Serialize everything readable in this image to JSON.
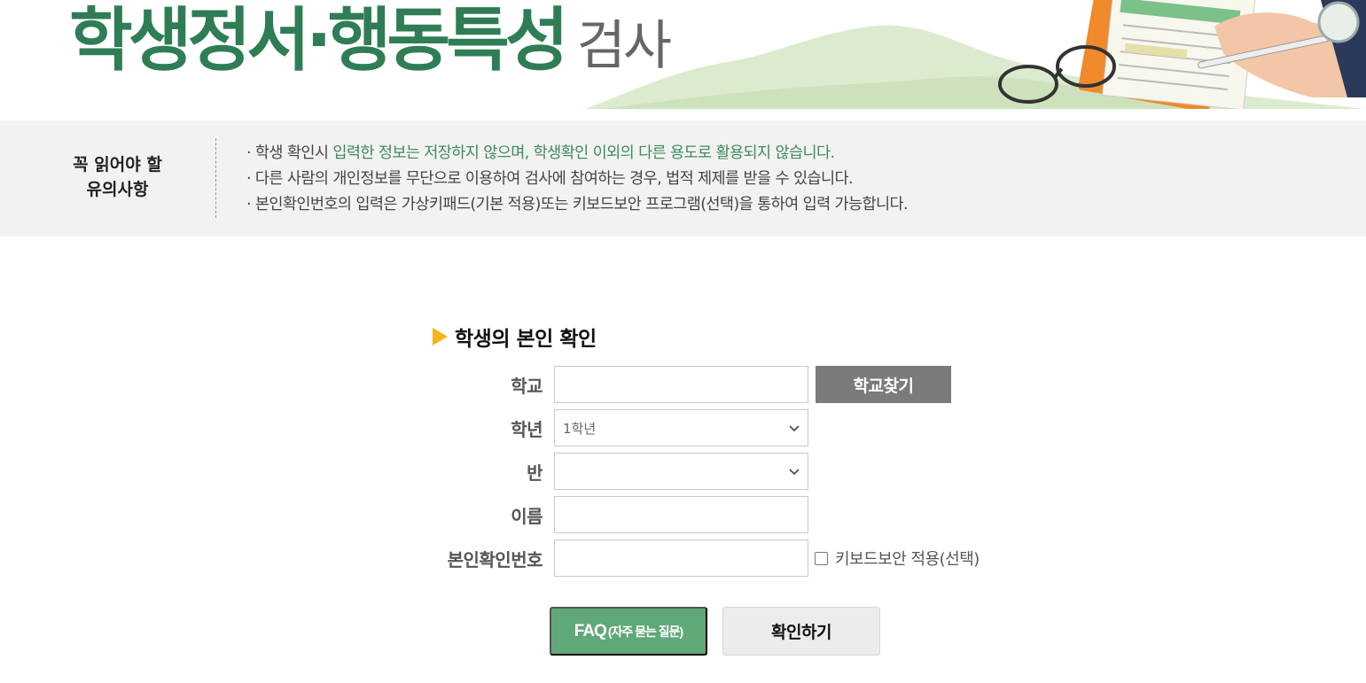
{
  "header": {
    "title_main": "학생정서·행동특성",
    "title_sub": "검사"
  },
  "notice": {
    "label_line1": "꼭 읽어야 할",
    "label_line2": "유의사항",
    "items": [
      {
        "pre": "· 학생 확인시 ",
        "hl1": "입력한 정보는 저장하지 않으며, 학생확인 이외의 다른 용도로 활용되지 않습니다.",
        "post": ""
      },
      {
        "pre": "· 다른 사람의 개인정보를 무단으로 이용하여 검사에 참여하는 경우, 법적 제제를 받을 수 있습니다.",
        "hl1": "",
        "post": ""
      },
      {
        "pre": "· 본인확인번호의 입력은 가상키패드(기본 적용)또는 키보드보안 프로그램(선택)을 통하여 입력 가능합니다.",
        "hl1": "",
        "post": ""
      }
    ]
  },
  "form": {
    "section_title": "학생의 본인 확인",
    "school_label": "학교",
    "school_value": "",
    "find_school_button": "학교찾기",
    "grade_label": "학년",
    "grade_selected": "1학년",
    "class_label": "반",
    "class_selected": "",
    "name_label": "이름",
    "name_value": "",
    "id_label": "본인확인번호",
    "id_value": "",
    "keyboard_security_label": "키보드보안 적용(선택)",
    "keyboard_security_checked": false
  },
  "buttons": {
    "faq_main": "FAQ",
    "faq_sub": "(자주 묻는 질문)",
    "confirm": "확인하기"
  },
  "colors": {
    "brand_green": "#2f7d54",
    "faq_green": "#61a878",
    "accent_yellow": "#f4b41a"
  }
}
